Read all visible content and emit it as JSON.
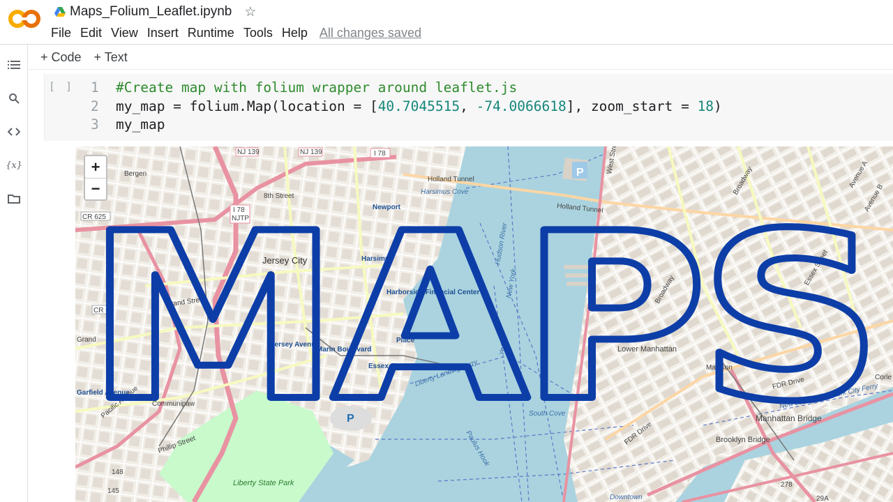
{
  "header": {
    "notebook_title": "Maps_Folium_Leaflet.ipynb",
    "logo_text": "CO",
    "menu": [
      "File",
      "Edit",
      "View",
      "Insert",
      "Runtime",
      "Tools",
      "Help"
    ],
    "save_status": "All changes saved"
  },
  "rail": {
    "icons": [
      "table-of-contents-icon",
      "search-icon",
      "code-snippets-icon",
      "variables-icon",
      "files-icon"
    ],
    "variables_glyph": "{x}"
  },
  "toolbar": {
    "add_code": "+ Code",
    "add_text": "+ Text"
  },
  "cell": {
    "run_label": "[ ]",
    "lines": [
      {
        "num": "1",
        "comment": "#Create map with folium wrapper around leaflet.js"
      },
      {
        "num": "2",
        "pre": "my_map = folium.Map(location = [",
        "lat": "40.7045515",
        "mid": ", ",
        "lon": "-74.0066618",
        "post": "], zoom_start = ",
        "zoom": "18",
        "end": ")"
      },
      {
        "num": "3",
        "text": "my_map"
      }
    ]
  },
  "map": {
    "zoom_in": "+",
    "zoom_out": "−",
    "overlay_text": "MAPS",
    "overlay_color": "#0d3ea8",
    "water_color": "#aad3df",
    "labels": {
      "bergen": "Bergen",
      "jersey_city": "Jersey City",
      "eighth_street": "8th Street",
      "newport": "Newport",
      "holland_tunnel": "Holland Tunnel",
      "holland_tunnel_2": "Holland Tunnel",
      "harsimus_cove": "Harsimus Cove",
      "harsimus": "Harsimus",
      "harborside": "Harborside Financial Center",
      "exchange_place": "Place",
      "marin_boulevard": "Marin Boulevard",
      "jersey_avenue": "Jersey Avenue",
      "essex_street": "Essex Street",
      "grand_street": "Grand Street",
      "communipaw": "Communipaw",
      "garfield_avenue": "Garfield Avenue",
      "pacific_avenue": "Pacific Avenue",
      "phillip_street": "Phillip Street",
      "liberty_state_park": "Liberty State Park",
      "lower_manhattan": "Lower Manhattan",
      "manhattan_bridge": "Manhattan Bridge",
      "brooklyn_bridge": "Brooklyn Bridge",
      "fdr_drive": "FDR Drive",
      "south_cove": "South Cove",
      "downtown": "Downtown",
      "hudson_river": "Hudson River",
      "new_york": "New York",
      "broadway": "Broadway",
      "west_street": "West Street",
      "avenue_a": "Avenue A",
      "avenue_b": "Avenue B",
      "essex_st2": "Essex Street",
      "madison": "Madison",
      "corlears": "Corle",
      "i78": "I 78",
      "nj139": "NJ 139",
      "njtp": "NJTP",
      "cr625": "CR 625",
      "cr6": "CR 6",
      "r148": "148",
      "r145": "145",
      "r278": "278",
      "r29a": "29A",
      "grand": "Grand",
      "liberty_landing": "Liberty Landing Ferry",
      "new_jersey_ferry": "New Jersey/New York City Ferry",
      "paulus_hook": "Paulus Hook",
      "york": "York",
      "p": "P"
    }
  }
}
